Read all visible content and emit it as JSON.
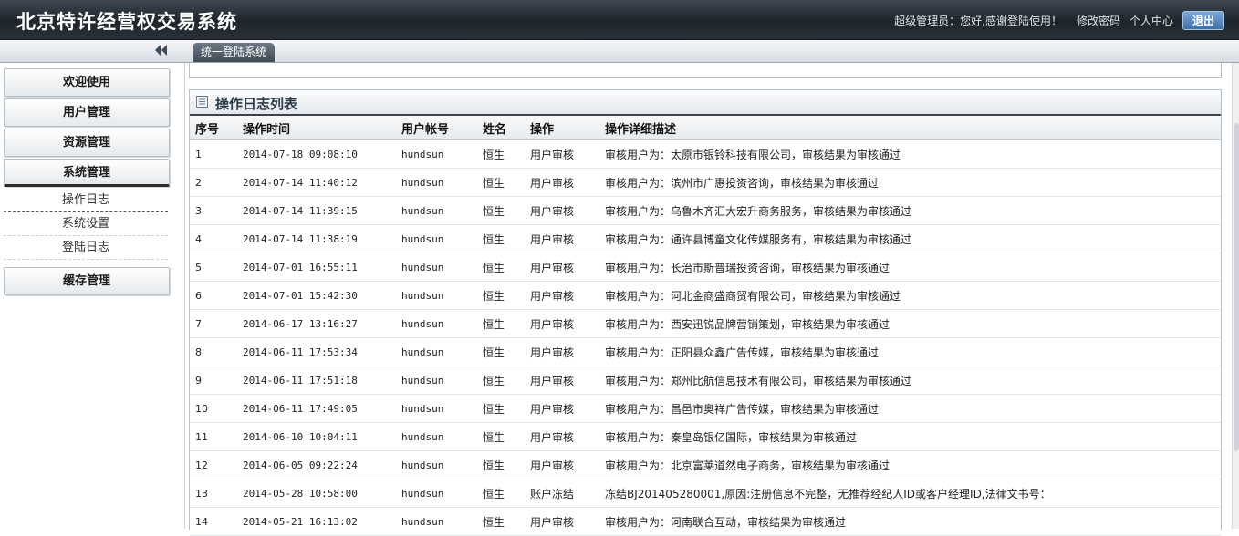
{
  "header": {
    "title": "北京特许经营权交易系统",
    "greeting": "超级管理员：您好,感谢登陆使用！",
    "change_password": "修改密码",
    "personal_center": "个人中心",
    "logout": "退出"
  },
  "tabs": {
    "active": "统一登陆系统"
  },
  "sidebar": {
    "items": [
      {
        "label": "欢迎使用"
      },
      {
        "label": "用户管理"
      },
      {
        "label": "资源管理"
      },
      {
        "label": "系统管理"
      },
      {
        "label": "缓存管理"
      }
    ],
    "sub_items": [
      {
        "label": "操作日志"
      },
      {
        "label": "系统设置"
      },
      {
        "label": "登陆日志"
      }
    ]
  },
  "panel": {
    "title": "操作日志列表",
    "columns": [
      "序号",
      "操作时间",
      "用户帐号",
      "姓名",
      "操作",
      "操作详细描述"
    ],
    "rows": [
      [
        "1",
        "2014-07-18 09:08:10",
        "hundsun",
        "恒生",
        "用户审核",
        "审核用户为：太原市银铃科技有限公司，审核结果为审核通过"
      ],
      [
        "2",
        "2014-07-14 11:40:12",
        "hundsun",
        "恒生",
        "用户审核",
        "审核用户为：滨州市广惠投资咨询，审核结果为审核通过"
      ],
      [
        "3",
        "2014-07-14 11:39:15",
        "hundsun",
        "恒生",
        "用户审核",
        "审核用户为：乌鲁木齐汇大宏升商务服务，审核结果为审核通过"
      ],
      [
        "4",
        "2014-07-14 11:38:19",
        "hundsun",
        "恒生",
        "用户审核",
        "审核用户为：通许县博童文化传媒服务有，审核结果为审核通过"
      ],
      [
        "5",
        "2014-07-01 16:55:11",
        "hundsun",
        "恒生",
        "用户审核",
        "审核用户为：长治市斯普瑞投资咨询，审核结果为审核通过"
      ],
      [
        "6",
        "2014-07-01 15:42:30",
        "hundsun",
        "恒生",
        "用户审核",
        "审核用户为：河北金商盛商贸有限公司，审核结果为审核通过"
      ],
      [
        "7",
        "2014-06-17 13:16:27",
        "hundsun",
        "恒生",
        "用户审核",
        "审核用户为：西安迅锐品牌营销策划，审核结果为审核通过"
      ],
      [
        "8",
        "2014-06-11 17:53:34",
        "hundsun",
        "恒生",
        "用户审核",
        "审核用户为：正阳县众鑫广告传媒，审核结果为审核通过"
      ],
      [
        "9",
        "2014-06-11 17:51:18",
        "hundsun",
        "恒生",
        "用户审核",
        "审核用户为：郑州比航信息技术有限公司，审核结果为审核通过"
      ],
      [
        "10",
        "2014-06-11 17:49:05",
        "hundsun",
        "恒生",
        "用户审核",
        "审核用户为：昌邑市奥祥广告传媒，审核结果为审核通过"
      ],
      [
        "11",
        "2014-06-10 10:04:11",
        "hundsun",
        "恒生",
        "用户审核",
        "审核用户为：秦皇岛银亿国际，审核结果为审核通过"
      ],
      [
        "12",
        "2014-06-05 09:22:24",
        "hundsun",
        "恒生",
        "用户审核",
        "审核用户为：北京富莱道然电子商务，审核结果为审核通过"
      ],
      [
        "13",
        "2014-05-28 10:58:00",
        "hundsun",
        "恒生",
        "账户冻结",
        "冻结BJ201405280001,原因:注册信息不完整，无推荐经纪人ID或客户经理ID,法律文书号："
      ],
      [
        "14",
        "2014-05-21 16:13:02",
        "hundsun",
        "恒生",
        "用户审核",
        "审核用户为：河南联合互动，审核结果为审核通过"
      ]
    ]
  },
  "colors": {
    "header_bg": "#1e252c",
    "tab_bg": "#3f4a55",
    "logout_bg": "#3d6fa8"
  }
}
